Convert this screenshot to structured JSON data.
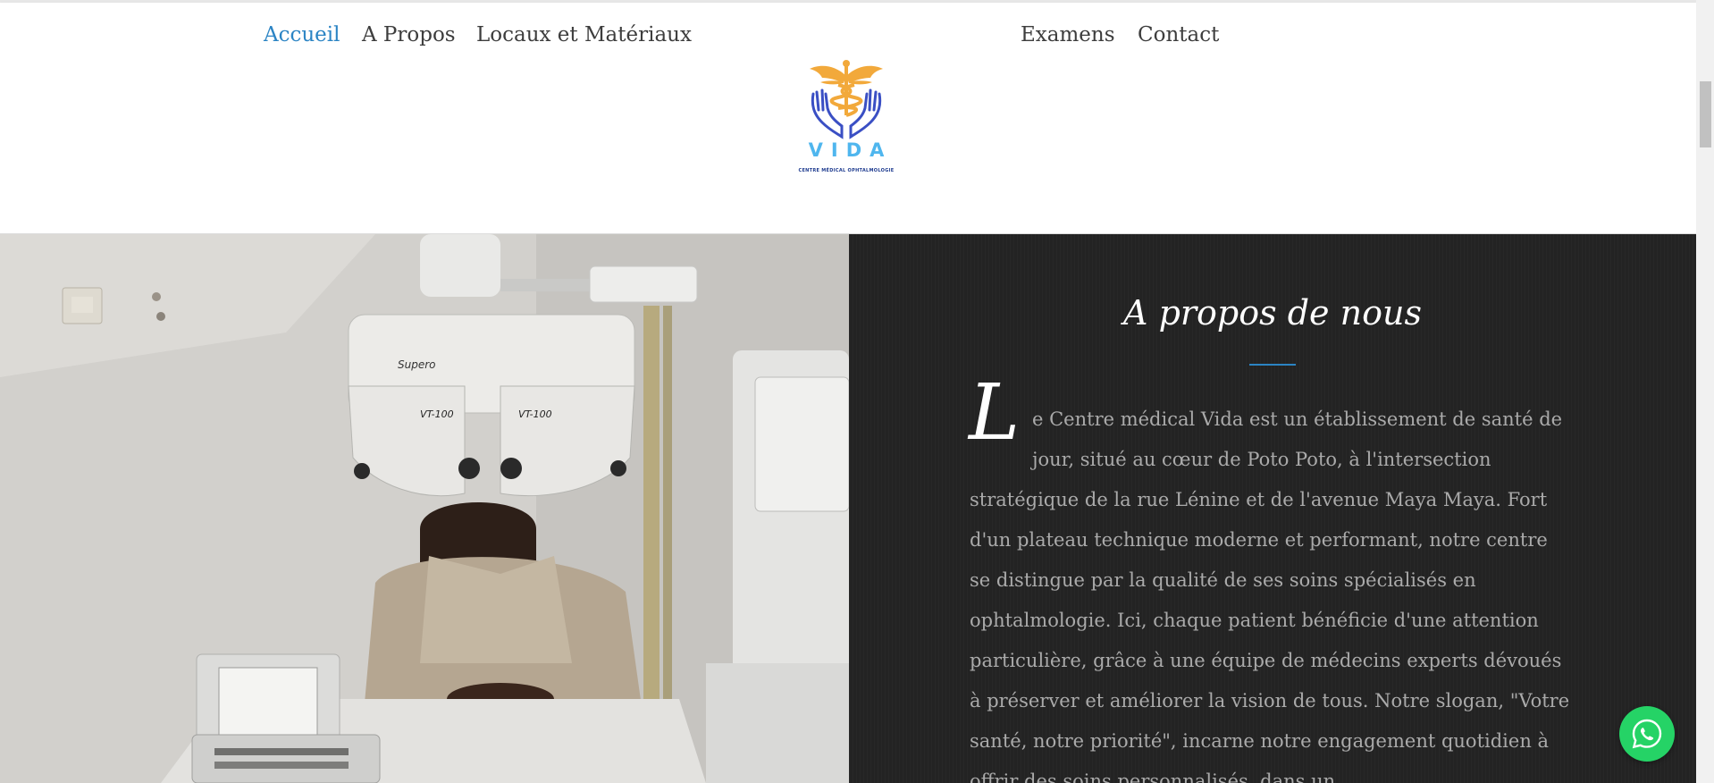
{
  "nav": {
    "items": [
      {
        "label": "Accueil",
        "active": true
      },
      {
        "label": "A Propos",
        "active": false
      },
      {
        "label": "Locaux et Matériaux",
        "active": false
      },
      {
        "label": "Examens",
        "active": false
      },
      {
        "label": "Contact",
        "active": false
      }
    ],
    "active_color": "#2b84c4",
    "text_color": "#3d3d3d"
  },
  "logo": {
    "name": "VIDA",
    "tagline": "CENTRE MÉDICAL OPHTALMOLOGIE",
    "colors": {
      "caduceus": "#f2a93b",
      "hands": "#3a4fc4",
      "wordmark": "#4fb6ee"
    }
  },
  "about": {
    "title": "A propos de nous",
    "dropcap": "L",
    "text": "e Centre médical Vida est un établissement de santé de jour, situé au cœur de Poto Poto, à l'intersection stratégique de la rue Lénine et de l'avenue Maya Maya. Fort d'un plateau technique moderne et performant, notre centre se distingue par la qualité de ses soins spécialisés en ophtalmologie. Ici, chaque patient bénéficie d'une attention particulière, grâce à une équipe de médecins experts dévoués à préserver et améliorer la vision de tous. Notre slogan, \"Votre santé, notre priorité\", incarne notre engagement quotidien à offrir des soins personnalisés, dans un",
    "background_color": "#232323",
    "accent_color": "#2b84c4"
  },
  "photo": {
    "equipment_labels": [
      "Supero",
      "VT-100",
      "VT-100"
    ]
  },
  "floating_button": {
    "icon": "whatsapp-icon",
    "color": "#25d366"
  }
}
